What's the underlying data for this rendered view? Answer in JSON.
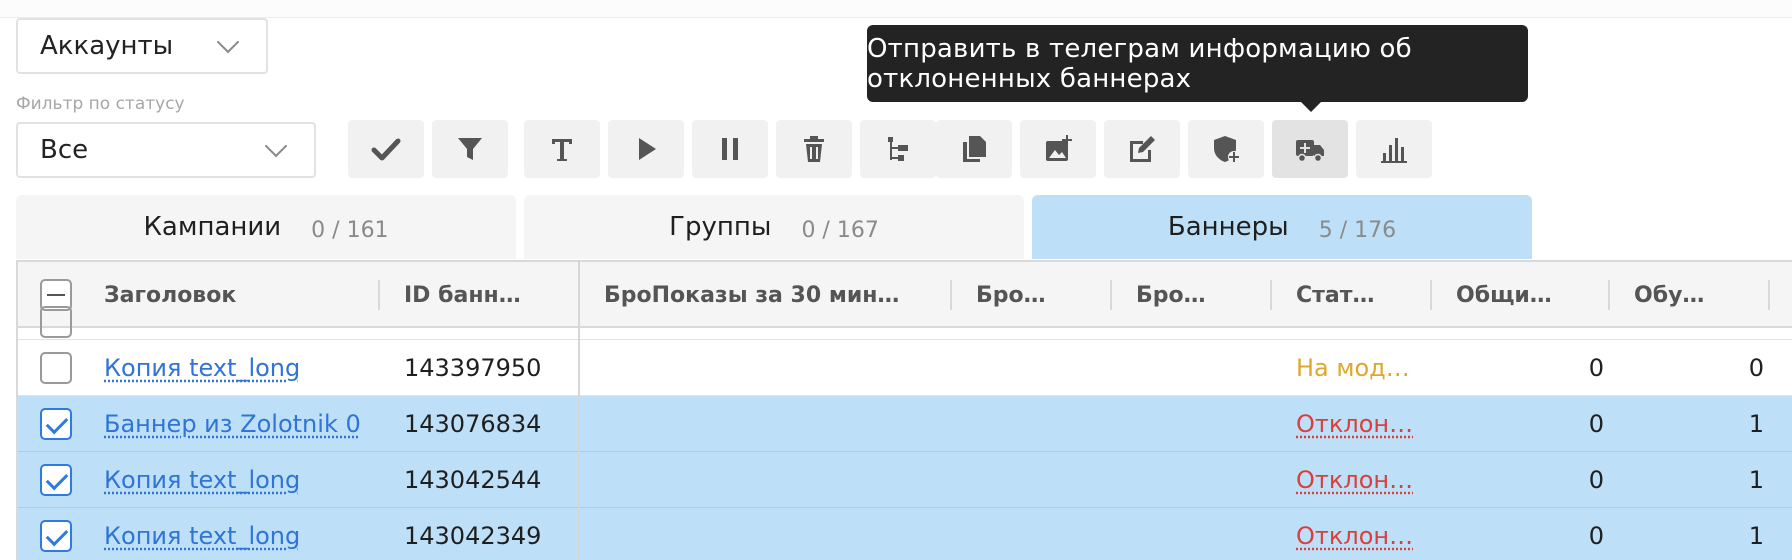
{
  "accounts_select": {
    "value": "Аккаунты"
  },
  "status_filter": {
    "label": "Фильтр по статусу",
    "value": "Все"
  },
  "tooltip": {
    "text": "Отправить в телеграм информацию об отклоненных баннерах"
  },
  "toolbar": {
    "buttons": [
      {
        "icon": "check-icon"
      },
      {
        "icon": "filter-icon"
      },
      {
        "icon": "text-icon"
      },
      {
        "icon": "play-icon"
      },
      {
        "icon": "pause-icon"
      },
      {
        "icon": "trash-icon"
      },
      {
        "icon": "hierarchy-icon"
      },
      {
        "icon": "copy-icon"
      },
      {
        "icon": "add-image-icon"
      },
      {
        "icon": "edit-icon"
      },
      {
        "icon": "shield-plus-icon"
      },
      {
        "icon": "ambulance-truck-icon"
      },
      {
        "icon": "bar-chart-icon"
      }
    ]
  },
  "tabs": [
    {
      "label": "Кампании",
      "count": "0 / 161"
    },
    {
      "label": "Группы",
      "count": "0 / 167"
    },
    {
      "label": "Баннеры",
      "count": "5 / 176"
    }
  ],
  "table": {
    "columns": [
      "Заголовок",
      "ID банн…",
      "БроПоказы за 30 мин…",
      "Бро…",
      "Бро…",
      "Стат…",
      "Общи…",
      "Обу…"
    ],
    "rows": [
      {
        "title": "Копия text_long",
        "id": "143397950",
        "status": "На мод…",
        "total": "0",
        "learn": "0"
      },
      {
        "title": "Баннер из Zolotnik 0",
        "id": "143076834",
        "status": "Отклон…",
        "total": "0",
        "learn": "1"
      },
      {
        "title": "Копия text_long",
        "id": "143042544",
        "status": "Отклон…",
        "total": "0",
        "learn": "1"
      },
      {
        "title": "Копия text_long",
        "id": "143042349",
        "status": "Отклон…",
        "total": "0",
        "learn": "1"
      }
    ]
  },
  "colors": {
    "selected_row": "#bde0f8",
    "link": "#2f74d6",
    "status_moderation": "#e0a82b",
    "status_rejected": "#d9403c",
    "tooltip_bg": "#232323"
  }
}
